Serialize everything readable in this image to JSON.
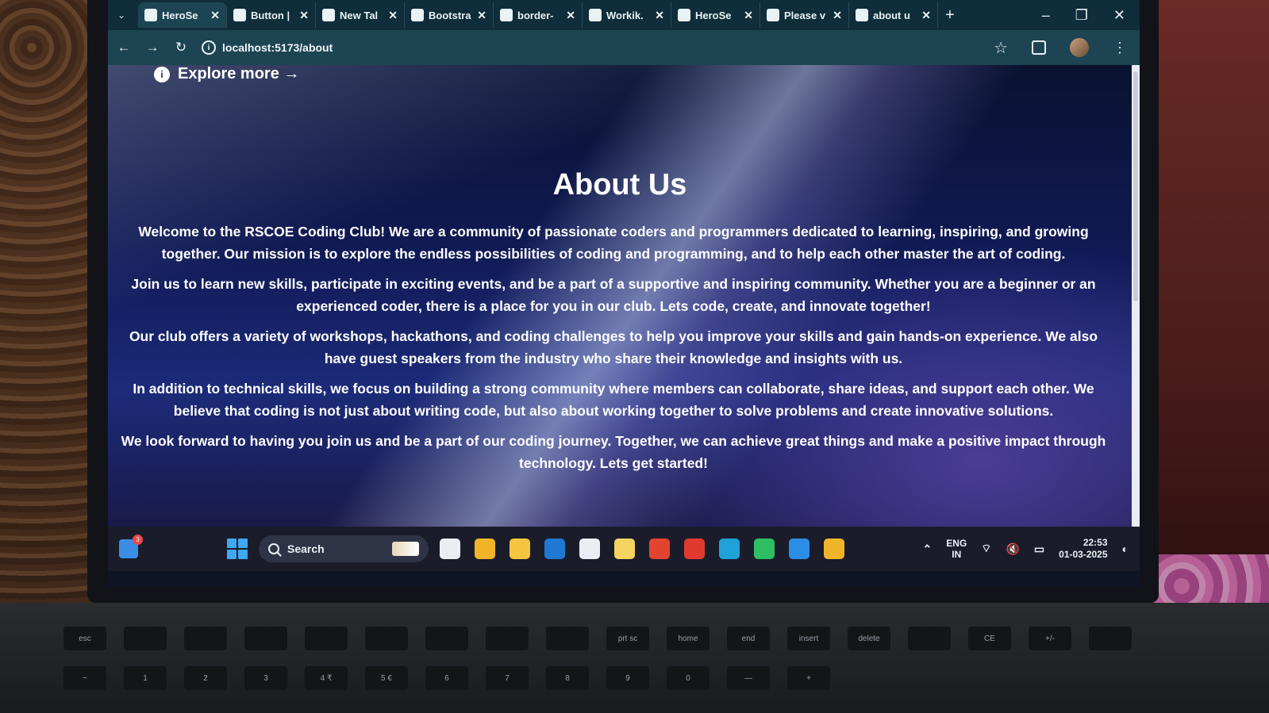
{
  "browser": {
    "tabs": [
      {
        "title": "HeroSe",
        "icon": "heroseo-icon",
        "active": true
      },
      {
        "title": "Button |",
        "icon": "ui-icon",
        "active": false
      },
      {
        "title": "New Tal",
        "icon": "chatgpt-icon",
        "active": false
      },
      {
        "title": "Bootstra",
        "icon": "bootstrap-icon",
        "active": false
      },
      {
        "title": "border-",
        "icon": "tailwind-icon",
        "active": false
      },
      {
        "title": "Workik.",
        "icon": "workik-icon",
        "active": false
      },
      {
        "title": "HeroSe",
        "icon": "heroseo-icon",
        "active": false
      },
      {
        "title": "Please v",
        "icon": "github-icon",
        "active": false
      },
      {
        "title": "about u",
        "icon": "chatgpt-icon",
        "active": false
      }
    ],
    "address": "localhost:5173/about"
  },
  "page": {
    "explore_label": "Explore more →",
    "title": "About Us",
    "paragraphs": [
      "Welcome to the RSCOE Coding Club! We are a community of passionate coders and programmers dedicated to learning, inspiring, and growing together. Our mission is to explore the endless possibilities of coding and programming, and to help each other master the art of coding.",
      "Join us to learn new skills, participate in exciting events, and be a part of a supportive and inspiring community. Whether you are a beginner or an experienced coder, there is a place for you in our club. Lets code, create, and innovate together!",
      "Our club offers a variety of workshops, hackathons, and coding challenges to help you improve your skills and gain hands-on experience. We also have guest speakers from the industry who share their knowledge and insights with us.",
      "In addition to technical skills, we focus on building a strong community where members can collaborate, share ideas, and support each other. We believe that coding is not just about writing code, but also about working together to solve problems and create innovative solutions.",
      "We look forward to having you join us and be a part of our coding journey. Together, we can achieve great things and make a positive impact through technology. Lets get started!"
    ]
  },
  "taskbar": {
    "widget_badge": "3",
    "search_label": "Search",
    "apps": [
      {
        "name": "task-view-icon",
        "color": "#e9eef4"
      },
      {
        "name": "chrome-icon",
        "color": "#f0b429"
      },
      {
        "name": "file-explorer-icon",
        "color": "#f5c542"
      },
      {
        "name": "outlook-icon",
        "color": "#1f78d1"
      },
      {
        "name": "store-icon",
        "color": "#e9eef4"
      },
      {
        "name": "sticky-notes-icon",
        "color": "#f4d35e"
      },
      {
        "name": "office-icon",
        "color": "#e2442f"
      },
      {
        "name": "youtube-icon",
        "color": "#e03a2f"
      },
      {
        "name": "edge-icon",
        "color": "#1fa2d8"
      },
      {
        "name": "whatsapp-icon",
        "color": "#2fbe62"
      },
      {
        "name": "vscode-icon",
        "color": "#2a8ee6"
      },
      {
        "name": "chrome-profile-icon",
        "color": "#f0b429"
      }
    ],
    "language_top": "ENG",
    "language_bottom": "IN",
    "time": "22:53",
    "date": "01-03-2025"
  },
  "keyboard": {
    "row1": [
      "esc",
      "",
      "",
      "",
      "",
      "",
      "",
      "",
      "",
      "prt sc",
      "home",
      "end",
      "insert",
      "delete",
      "",
      "CE",
      "+/-",
      ""
    ],
    "row2": [
      "~",
      "1",
      "2",
      "3",
      "4 ₹",
      "5 €",
      "6",
      "7",
      "8",
      "9",
      "0",
      "—",
      "+"
    ]
  }
}
